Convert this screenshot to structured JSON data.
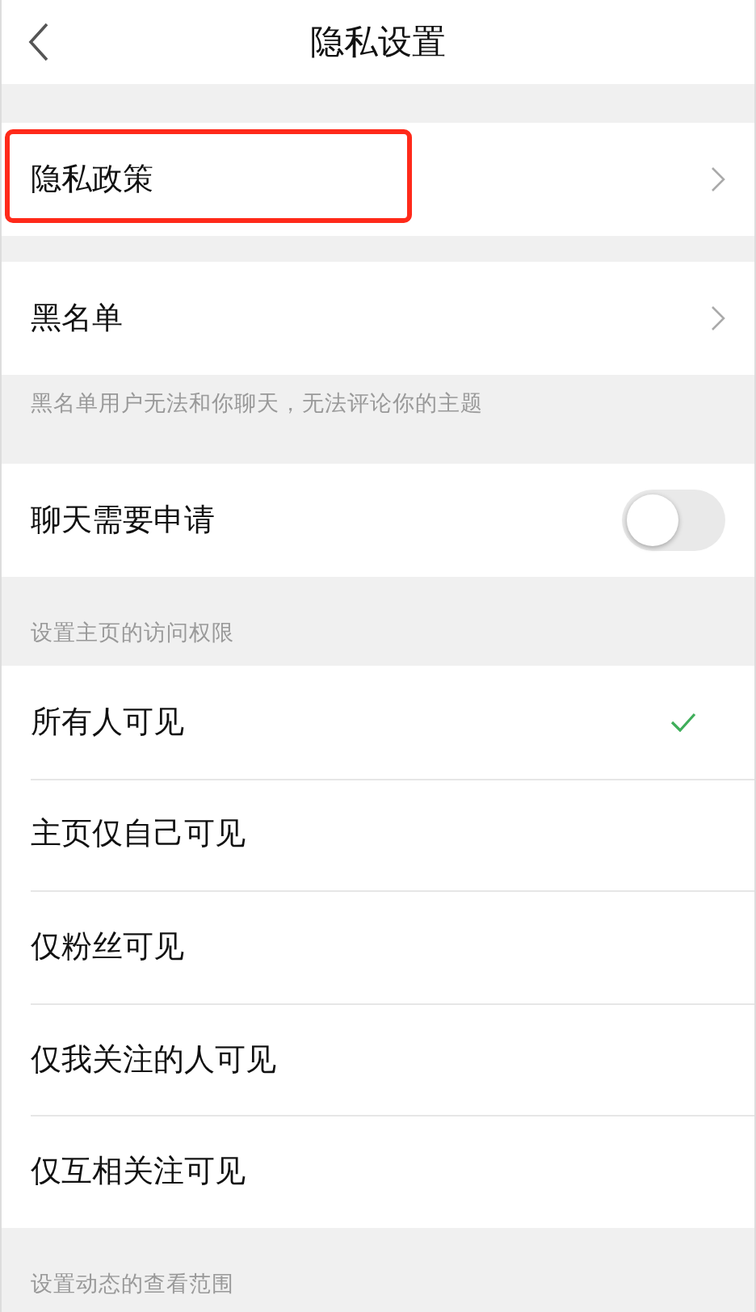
{
  "header": {
    "title": "隐私设置"
  },
  "blocks": [
    {
      "kind": "gap"
    },
    {
      "kind": "link",
      "label": "隐私政策",
      "highlighted": true
    },
    {
      "kind": "gap"
    },
    {
      "kind": "link",
      "label": "黑名单",
      "highlighted": false
    },
    {
      "kind": "note",
      "text": "黑名单用户无法和你聊天，无法评论你的主题"
    },
    {
      "kind": "toggle",
      "label": "聊天需要申请",
      "on": false
    },
    {
      "kind": "heading",
      "text": "设置主页的访问权限"
    },
    {
      "kind": "choice",
      "label": "所有人可见",
      "selected": true
    },
    {
      "kind": "choice",
      "label": "主页仅自己可见",
      "selected": false
    },
    {
      "kind": "choice",
      "label": "仅粉丝可见",
      "selected": false
    },
    {
      "kind": "choice",
      "label": "仅我关注的人可见",
      "selected": false
    },
    {
      "kind": "choice",
      "label": "仅互相关注可见",
      "selected": false
    },
    {
      "kind": "heading",
      "text": "设置动态的查看范围"
    }
  ]
}
